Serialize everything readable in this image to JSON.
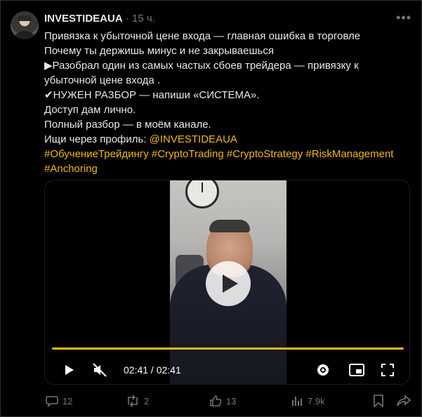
{
  "author": {
    "name": "INVESTIDEAUA",
    "dot": "·",
    "time": "15 ч."
  },
  "post": {
    "line1": "Привязка к убыточной цене входа — главная ошибка в торговле",
    "line2": "Почему ты держишь минус и не закрываешься",
    "line3": "▶Разобрал один из самых частых сбоев трейдера — привязку к убыточной цене входа .",
    "line4": "✔НУЖЕН РАЗБОР — напиши «СИСТЕМА».",
    "line5": "Доступ дам лично.",
    "line6": "Полный разбор — в моём канале.",
    "line7_prefix": "Ищи через профиль: ",
    "line7_mention": "@INVESTIDEAUA",
    "hashtags_line1": "#ОбучениеТрейдингу #CryptoTrading #CryptoStrategy #RiskManagement",
    "hashtags_line2": "#Anchoring"
  },
  "video": {
    "time": "02:41 / 02:41",
    "progress": 1.0
  },
  "actions": {
    "replies": "12",
    "reposts": "2",
    "likes": "13",
    "views": "7.9k"
  },
  "colors": {
    "accent": "#f0b90b",
    "muted": "#71767b",
    "text": "#e7e9ea"
  }
}
